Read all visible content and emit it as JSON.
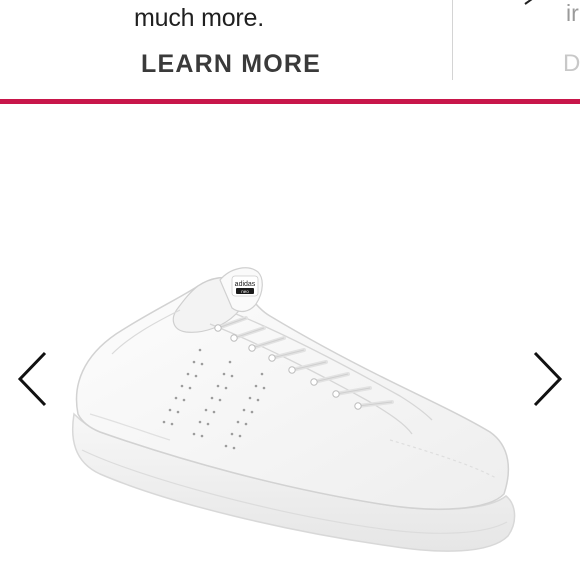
{
  "promo": {
    "text": "much more.",
    "cta_label": "LEARN MORE",
    "next_card_text": "ir",
    "next_card_cta": "D"
  },
  "colors": {
    "accent": "#c8164a",
    "text_dark": "#1f1f1f",
    "cta_text": "#3a3a3a"
  },
  "gallery": {
    "prev_icon": "chevron-left-icon",
    "next_icon": "chevron-right-icon",
    "product_image": "white-sneaker",
    "shoe_logo_text": "adidas",
    "shoe_tag_text": "neo"
  }
}
